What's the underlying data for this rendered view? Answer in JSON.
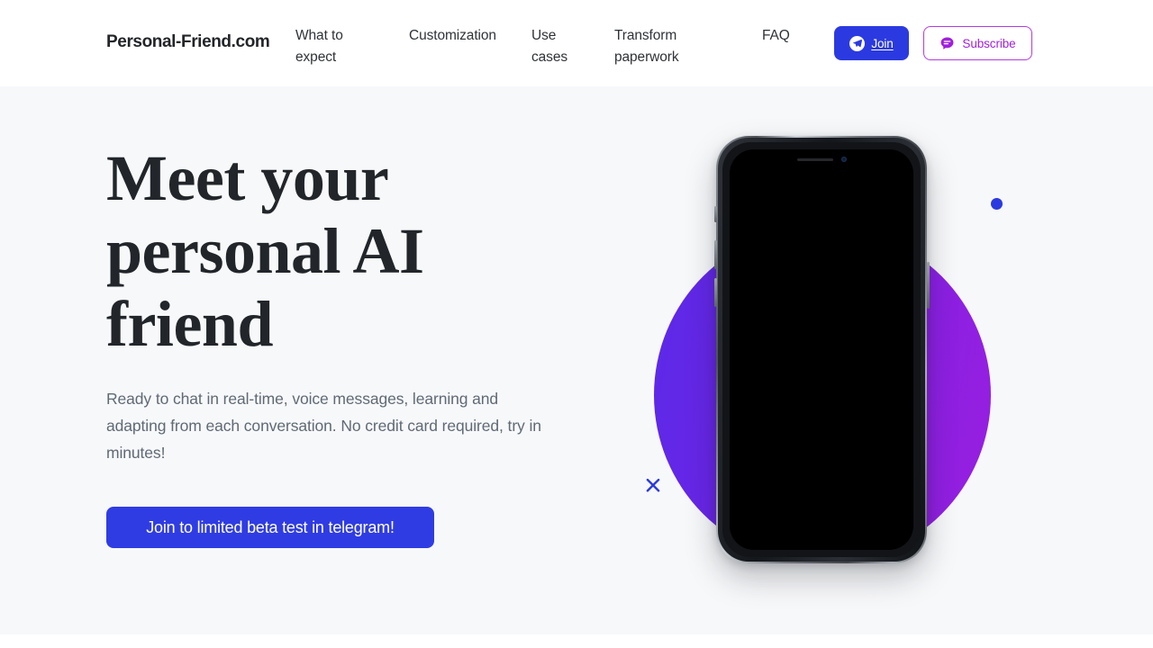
{
  "header": {
    "logo": "Personal-Friend.com",
    "nav": [
      {
        "label": "What to expect",
        "name": "nav-what-to-expect"
      },
      {
        "label": "Customization",
        "name": "nav-customization"
      },
      {
        "label": "Use cases",
        "name": "nav-use-cases"
      },
      {
        "label": "Transform paperwork",
        "name": "nav-transform-paperwork"
      },
      {
        "label": "FAQ",
        "name": "nav-faq"
      }
    ],
    "join_button": {
      "label": "Join",
      "icon": "telegram-icon"
    },
    "subscribe_button": {
      "label": "Subscribe",
      "icon": "chat-bubble-icon"
    }
  },
  "hero": {
    "headline": "Meet your personal AI friend",
    "subtext": "Ready to chat in real-time, voice messages, learning and adapting from each conversation. No credit card required, try in minutes!",
    "cta_label": "Join to limited beta test in telegram!"
  },
  "visual": {
    "phone_mockup": "iphone-mockup",
    "screen_state": "black",
    "decorations": {
      "gradient_circle": "gradient-circle",
      "blue_dot": "blue-dot",
      "blue_cross": "blue-cross"
    }
  },
  "colors": {
    "page_background": "#ffffff",
    "hero_background": "#f7f8fa",
    "accent_blue": "#2b3ae0",
    "cta_blue": "#2f3ce4",
    "accent_purple": "#a020dd",
    "subscribe_border": "#b43ce0",
    "headline_text": "#22262b",
    "body_text": "#5f6a75",
    "nav_text": "#2f3338",
    "gradient_start": "#5a2ae8",
    "gradient_end": "#9a1fe0",
    "phone_screen": "#000000"
  }
}
